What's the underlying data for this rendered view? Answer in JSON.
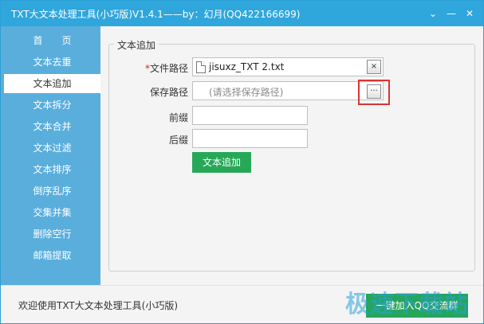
{
  "window": {
    "title": "TXT大文本处理工具(小巧版)V1.4.1——by：幻月(QQ422166699)",
    "menu_icon": "chevron-down-icon",
    "min_icon": "minimize-icon",
    "close_icon": "close-icon",
    "menu_glyph": "⌄",
    "min_glyph": "—",
    "close_glyph": "✕"
  },
  "sidebar": {
    "items": [
      {
        "label": "首　　页"
      },
      {
        "label": "文本去重"
      },
      {
        "label": "文本追加",
        "active": true
      },
      {
        "label": "文本拆分"
      },
      {
        "label": "文本合并"
      },
      {
        "label": "文本过滤"
      },
      {
        "label": "文本排序"
      },
      {
        "label": "倒序乱序"
      },
      {
        "label": "交集并集"
      },
      {
        "label": "删除空行"
      },
      {
        "label": "邮箱提取"
      }
    ]
  },
  "form": {
    "group_title": "文本追加",
    "file_path": {
      "required_mark": "*",
      "label": "文件路径",
      "value": "jisuxz_TXT 2.txt",
      "clear_glyph": "×"
    },
    "save_path": {
      "label": "保存路径",
      "placeholder": "(请选择保存路径)",
      "browse_glyph": "···"
    },
    "prefix": {
      "label": "前缀",
      "value": ""
    },
    "suffix": {
      "label": "后缀",
      "value": ""
    },
    "submit_label": "文本追加"
  },
  "statusbar": {
    "text": "欢迎使用TXT大文本处理工具(小巧版)",
    "join_label": "一键加入QQ交流群"
  },
  "watermark": "极速下载站",
  "colors": {
    "titlebar": "#2fa6dc",
    "sidebar": "#5aaedc",
    "accent_green": "#27a857",
    "highlight_red": "#dd3333"
  }
}
